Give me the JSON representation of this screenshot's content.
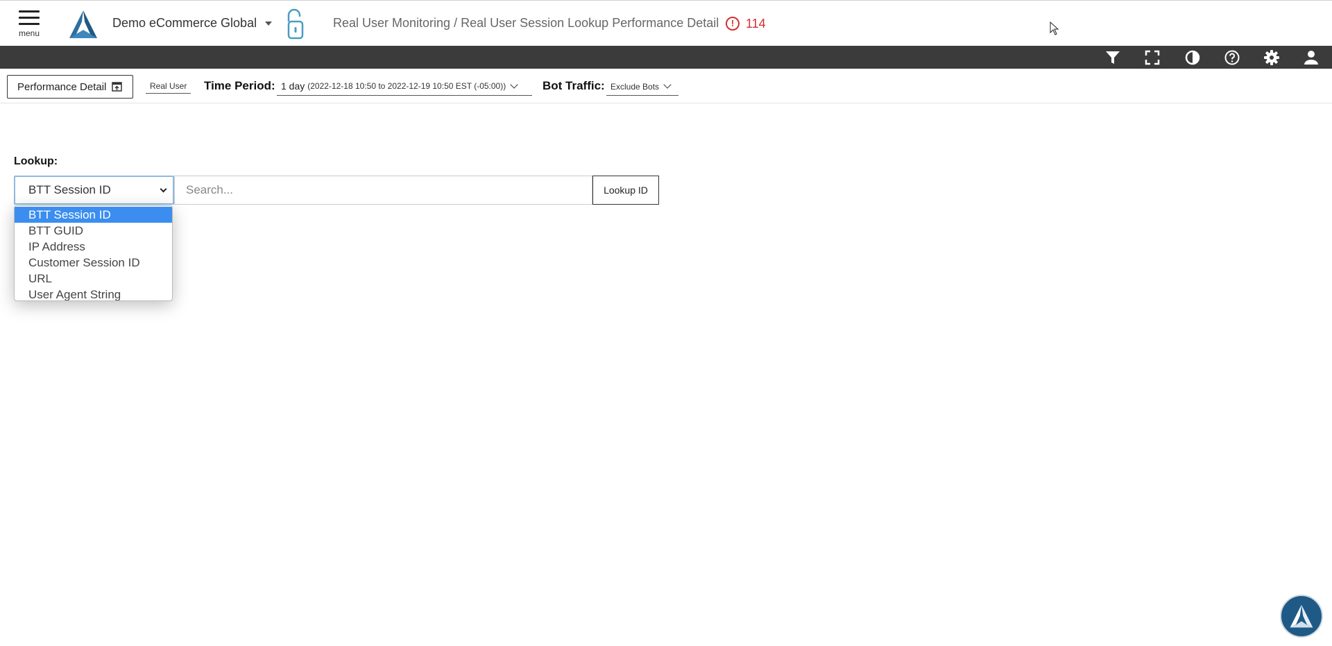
{
  "header": {
    "menu_label": "menu",
    "org_name": "Demo eCommerce Global",
    "breadcrumb": "Real User Monitoring / Real User Session Lookup Performance Detail",
    "alert_count": "114",
    "alert_symbol": "!"
  },
  "toolbar": {
    "icons": [
      "filter-icon",
      "fullscreen-icon",
      "contrast-icon",
      "help-icon",
      "settings-icon",
      "user-icon"
    ],
    "background": "#3b3b3b"
  },
  "filters": {
    "performance_detail_label": "Performance Detail",
    "real_user_label": "Real User",
    "time_period_label": "Time Period:",
    "time_period_value": "1 day",
    "time_period_range": "(2022-12-18 10:50 to 2022-12-19 10:50 EST (-05:00))",
    "bot_traffic_label": "Bot Traffic:",
    "bot_traffic_value": "Exclude Bots"
  },
  "lookup": {
    "label": "Lookup:",
    "selected": "BTT Session ID",
    "search_placeholder": "Search...",
    "search_value": "",
    "button_label": "Lookup ID",
    "options": [
      "BTT Session ID",
      "BTT GUID",
      "IP Address",
      "Customer Session ID",
      "URL",
      "User Agent String"
    ]
  },
  "colors": {
    "brand": "#1f5a86",
    "alert": "#d32f2f",
    "option_highlight": "#3b8ef0",
    "lock_icon": "#4a9cc4"
  }
}
